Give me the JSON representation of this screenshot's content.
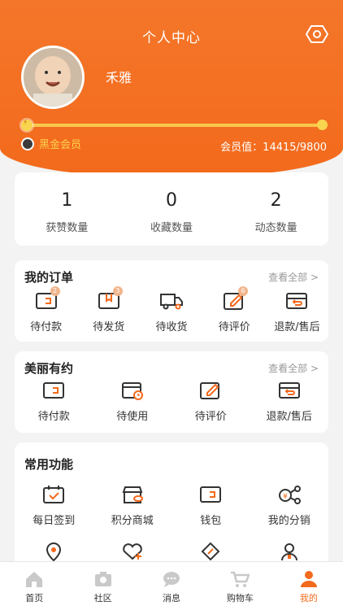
{
  "header": {
    "title": "个人中心",
    "settings_icon": "settings-hexagon-icon"
  },
  "profile": {
    "name": "禾雅",
    "avatar_icon": "baby-avatar",
    "level_progress": 1.0
  },
  "membership": {
    "badge": "黑金会员",
    "value_text": "会员值：14415/9800"
  },
  "stats": [
    {
      "value": "1",
      "label": "获赞数量"
    },
    {
      "value": "0",
      "label": "收藏数量"
    },
    {
      "value": "2",
      "label": "动态数量"
    }
  ],
  "orders": {
    "title": "我的订单",
    "more": "查看全部 >",
    "items": [
      {
        "label": "待付款",
        "badge": "2",
        "icon": "wallet-icon"
      },
      {
        "label": "待发货",
        "badge": "3",
        "icon": "box-icon"
      },
      {
        "label": "待收货",
        "badge": "",
        "icon": "truck-icon"
      },
      {
        "label": "待评价",
        "badge": "6",
        "icon": "edit-icon"
      },
      {
        "label": "退款/售后",
        "badge": "",
        "icon": "refund-icon"
      }
    ]
  },
  "appointments": {
    "title": "美丽有约",
    "more": "查看全部 >",
    "items": [
      {
        "label": "待付款",
        "icon": "wallet-icon"
      },
      {
        "label": "待使用",
        "icon": "calendar-clock-icon"
      },
      {
        "label": "待评价",
        "icon": "edit-icon"
      },
      {
        "label": "退款/售后",
        "icon": "refund-icon"
      }
    ]
  },
  "functions": {
    "title": "常用功能",
    "items": [
      {
        "label": "每日签到",
        "icon": "checkin-calendar-icon"
      },
      {
        "label": "积分商城",
        "icon": "points-store-icon"
      },
      {
        "label": "钱包",
        "icon": "wallet-icon"
      },
      {
        "label": "我的分销",
        "icon": "share-network-icon"
      }
    ],
    "partial_icons": [
      "location-pin-icon",
      "heart-plus-icon",
      "coupon-icon",
      "user-icon"
    ]
  },
  "tabs": [
    {
      "label": "首页",
      "icon": "home-icon",
      "active": false
    },
    {
      "label": "社区",
      "icon": "camera-icon",
      "active": false
    },
    {
      "label": "消息",
      "icon": "chat-icon",
      "active": false
    },
    {
      "label": "购物车",
      "icon": "cart-icon",
      "active": false
    },
    {
      "label": "我的",
      "icon": "person-icon",
      "active": true
    }
  ],
  "colors": {
    "brand": "#f36a1c",
    "gold": "#fbd34d",
    "icon_stroke": "#333333",
    "icon_accent": "#f36a1c"
  }
}
